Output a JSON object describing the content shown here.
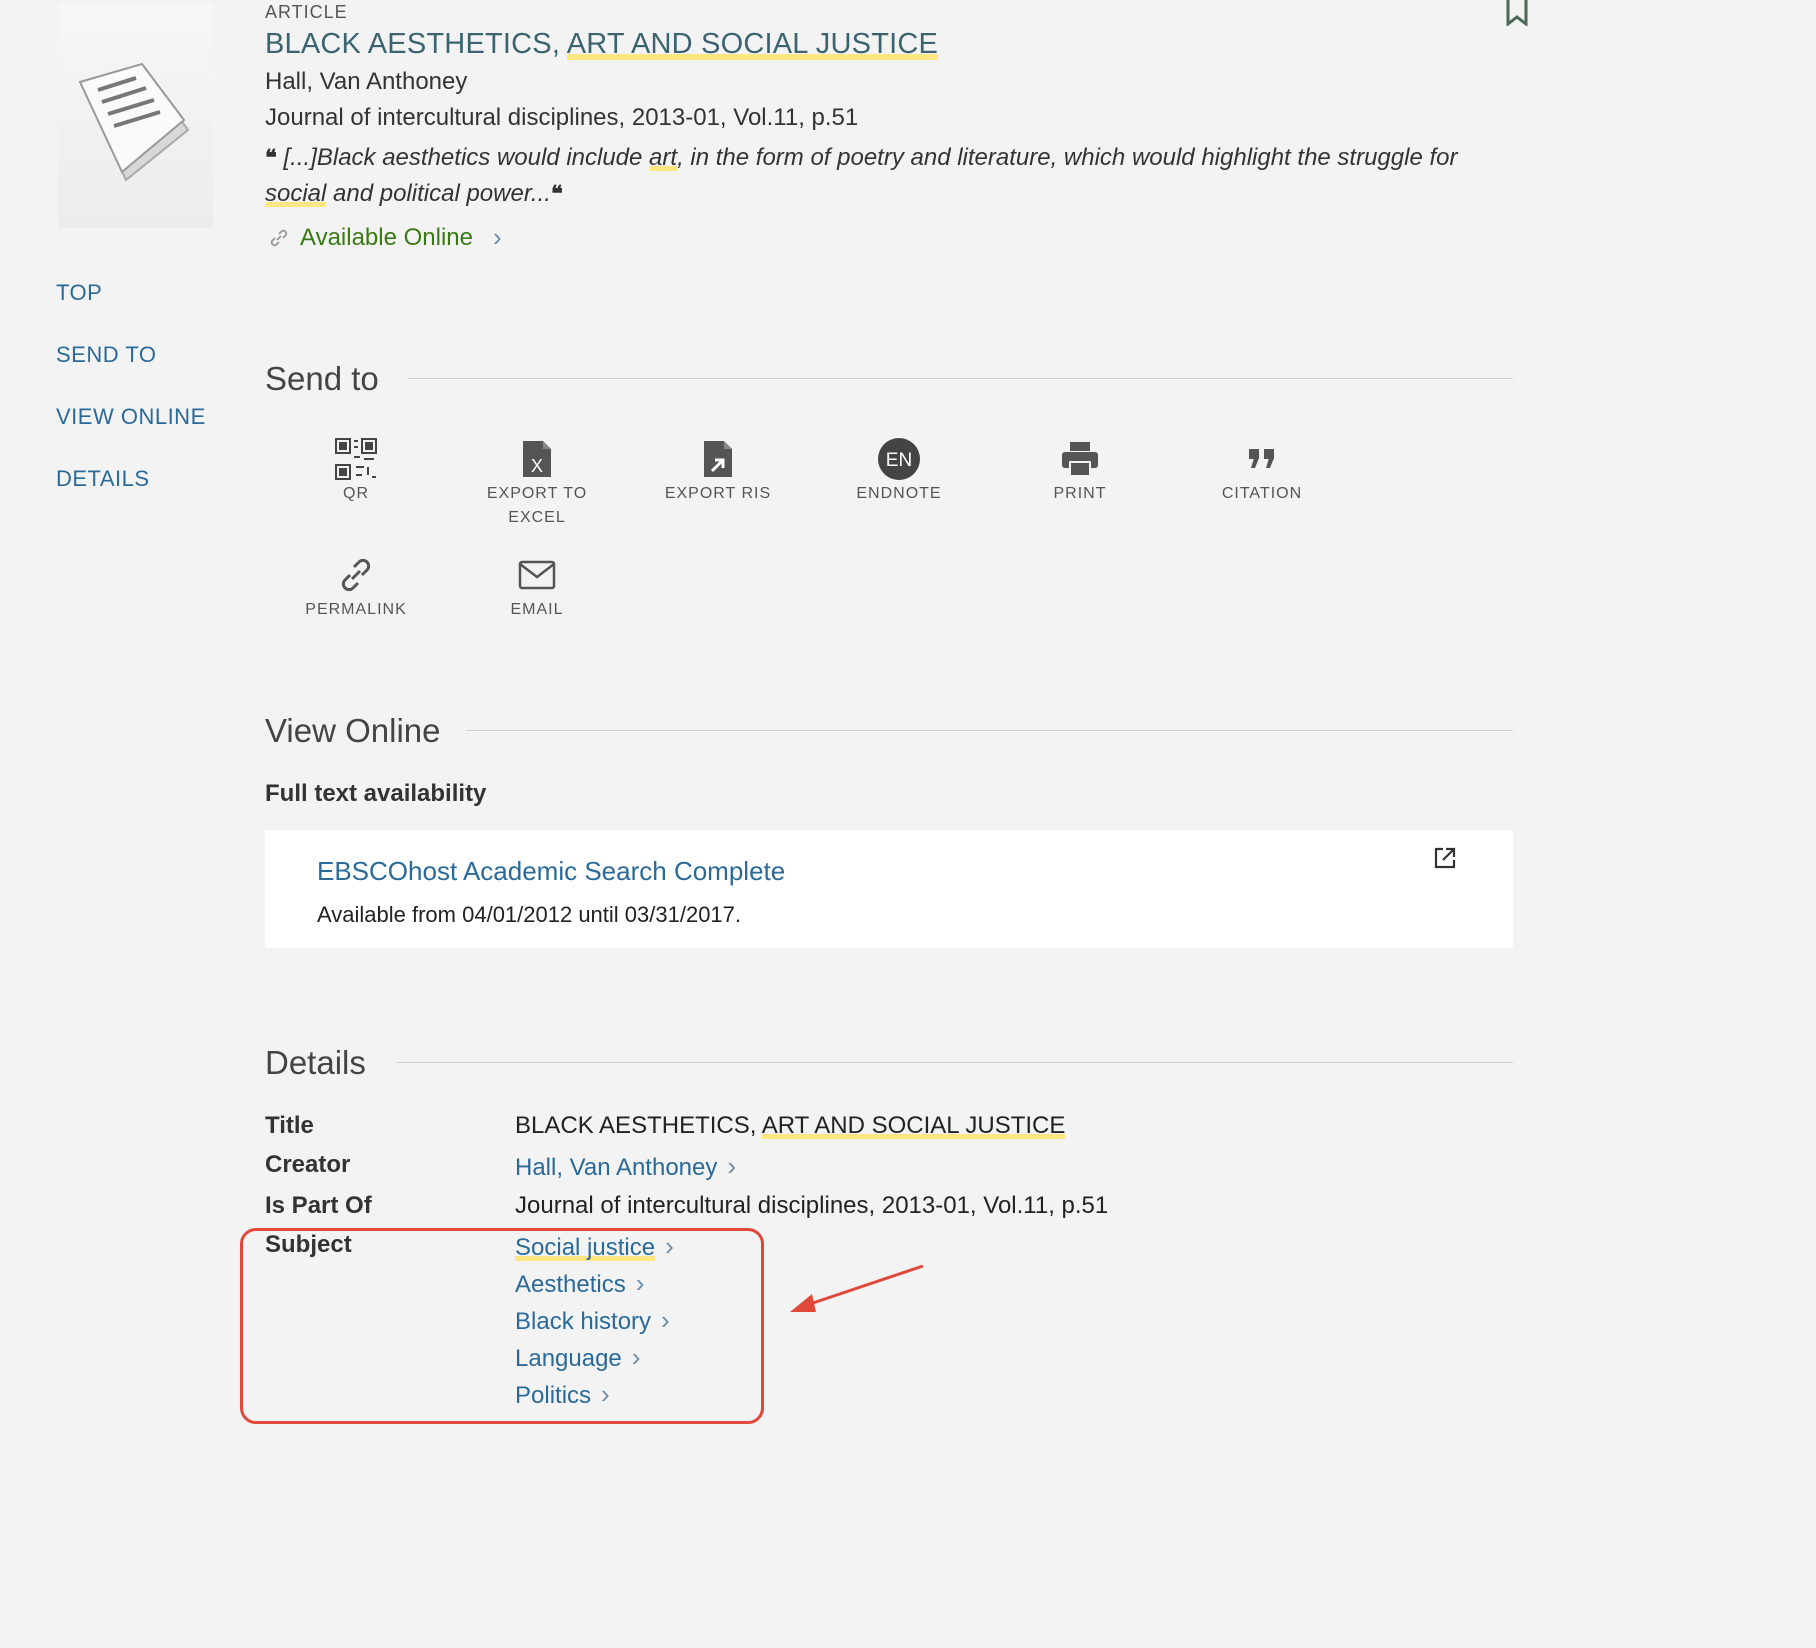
{
  "record": {
    "type": "ARTICLE",
    "title_plain": "BLACK AESTHETICS, ",
    "title_hl": "ART AND SOCIAL JUSTICE",
    "author": "Hall, Van Anthoney",
    "journal": "Journal of intercultural disciplines, 2013-01, Vol.11, p.51",
    "snippet": {
      "open_quote": "❝",
      "part1": "[...]Black aesthetics would include ",
      "hl1": "art",
      "part2": ", in the form of poetry and literature, which would highlight the struggle for ",
      "hl2": "social",
      "part3": " and political power...",
      "close_quote": "❝"
    },
    "availability": "Available Online"
  },
  "nav": [
    "TOP",
    "SEND TO",
    "VIEW ONLINE",
    "DETAILS"
  ],
  "send_to": {
    "heading": "Send to",
    "actions": [
      {
        "label": "QR",
        "icon": "qr-icon"
      },
      {
        "label": "EXPORT TO EXCEL",
        "icon": "excel-icon"
      },
      {
        "label": "EXPORT RIS",
        "icon": "export-ris-icon"
      },
      {
        "label": "ENDNOTE",
        "icon": "endnote-icon",
        "badge": "EN"
      },
      {
        "label": "PRINT",
        "icon": "print-icon"
      },
      {
        "label": "CITATION",
        "icon": "citation-icon"
      },
      {
        "label": "PERMALINK",
        "icon": "permalink-icon"
      },
      {
        "label": "EMAIL",
        "icon": "email-icon"
      }
    ]
  },
  "view_online": {
    "heading": "View Online",
    "full_text_label": "Full text availability",
    "provider": "EBSCOhost Academic Search Complete",
    "coverage": "Available from 04/01/2012 until 03/31/2017."
  },
  "details": {
    "heading": "Details",
    "title_label": "Title",
    "title_plain": "BLACK AESTHETICS, ",
    "title_hl": "ART AND SOCIAL JUSTICE",
    "creator_label": "Creator",
    "creator": "Hall, Van Anthoney",
    "ispartof_label": "Is Part Of",
    "ispartof": "Journal of intercultural disciplines, 2013-01, Vol.11, p.51",
    "subject_label": "Subject",
    "subjects": [
      "Social justice",
      "Aesthetics",
      "Black history",
      "Language",
      "Politics"
    ]
  },
  "colors": {
    "annotation": "#e0493a",
    "link": "#2a6a99",
    "highlight": "#ffe680"
  }
}
